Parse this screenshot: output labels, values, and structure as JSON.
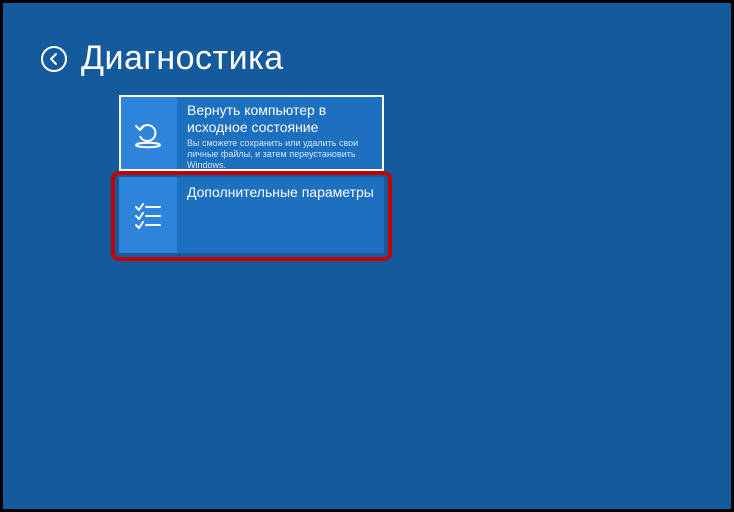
{
  "header": {
    "title": "Диагностика"
  },
  "tiles": [
    {
      "title": "Вернуть компьютер в исходное состояние",
      "description": "Вы сможете сохранить или удалить свои личные файлы, и затем переустановить Windows."
    },
    {
      "title": "Дополнительные параметры",
      "description": ""
    }
  ],
  "colors": {
    "background": "#165a9e",
    "tile": "#1d6fbf",
    "tile_icon_bg": "#2d84da",
    "highlight": "#c40101"
  }
}
